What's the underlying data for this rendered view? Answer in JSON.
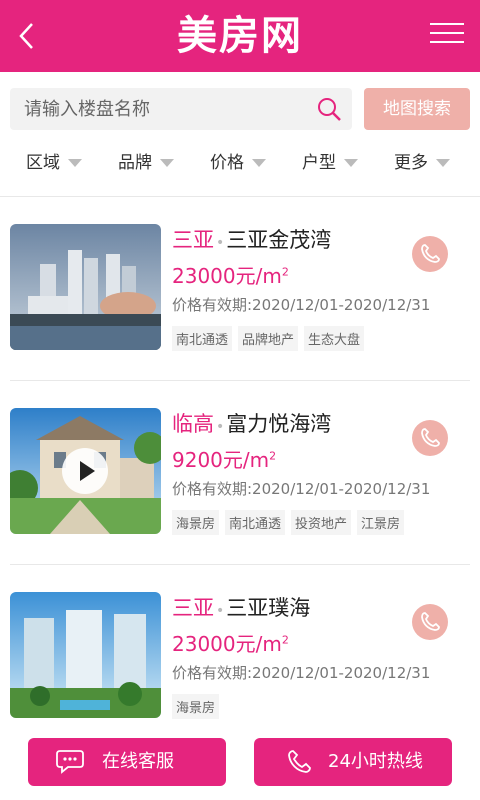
{
  "header": {
    "title": "美房网"
  },
  "search": {
    "placeholder": "请输入楼盘名称",
    "map_button": "地图搜索"
  },
  "filters": [
    "区域",
    "品牌",
    "价格",
    "户型",
    "更多"
  ],
  "listings": [
    {
      "city": "三亚",
      "name": "三亚金茂湾",
      "price": "23000元/m",
      "price_unit_sup": "2",
      "valid": "价格有效期:2020/12/01-2020/12/31",
      "tags": [
        "南北通透",
        "品牌地产",
        "生态大盘"
      ],
      "has_video": false
    },
    {
      "city": "临高",
      "name": "富力悦海湾",
      "price": "9200元/m",
      "price_unit_sup": "2",
      "valid": "价格有效期:2020/12/01-2020/12/31",
      "tags": [
        "海景房",
        "南北通透",
        "投资地产",
        "江景房"
      ],
      "has_video": true
    },
    {
      "city": "三亚",
      "name": "三亚璞海",
      "price": "23000元/m",
      "price_unit_sup": "2",
      "valid": "价格有效期:2020/12/01-2020/12/31",
      "tags": [
        "海景房"
      ],
      "has_video": false
    }
  ],
  "bottom_bar": {
    "service_label": "在线客服",
    "hotline_label": "24小时热线"
  },
  "colors": {
    "brand": "#e5247e",
    "accent_light": "#efb0a9"
  }
}
